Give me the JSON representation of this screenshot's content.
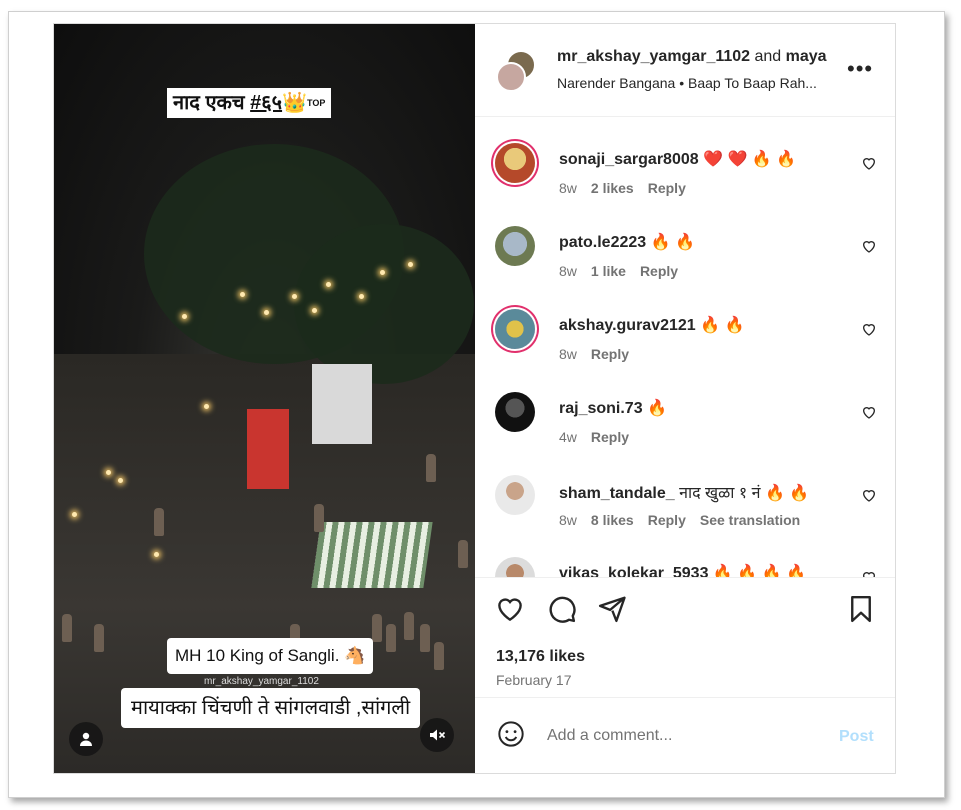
{
  "video": {
    "caption_top": "नाद एकच",
    "caption_top_tag": "#६५",
    "caption_top_emoji": "👑",
    "caption_top_badge": "TOP",
    "caption_mid": "MH 10 King of Sangli. 🐴",
    "caption_handle": "mr_akshay_yamgar_1102",
    "caption_bottom": "मायाक्का चिंचणी ते सांगलवाडी ,सांगली",
    "user_icon": "user-icon",
    "mute_icon": "muted-speaker-icon"
  },
  "header": {
    "author": "mr_akshay_yamgar_1102",
    "joiner": "and",
    "coauthor": "maya",
    "subtitle": "Narender Bangana • Baap To Baap Rah...",
    "more_icon": "•••"
  },
  "comments": [
    {
      "username": "sonaji_sargar8008",
      "text": "❤️ ❤️ 🔥 🔥",
      "age": "8w",
      "likes": "2 likes",
      "reply": "Reply",
      "translate": ""
    },
    {
      "username": "pato.le2223",
      "text": "🔥 🔥",
      "age": "8w",
      "likes": "1 like",
      "reply": "Reply",
      "translate": ""
    },
    {
      "username": "akshay.gurav2121",
      "text": "🔥 🔥",
      "age": "8w",
      "likes": "",
      "reply": "Reply",
      "translate": ""
    },
    {
      "username": "raj_soni.73",
      "text": "🔥",
      "age": "4w",
      "likes": "",
      "reply": "Reply",
      "translate": ""
    },
    {
      "username": "sham_tandale_",
      "text": "नाद खुळा १ नं 🔥 🔥",
      "age": "8w",
      "likes": "8 likes",
      "reply": "Reply",
      "translate": "See translation"
    },
    {
      "username": "vikas_kolekar_5933",
      "text": "🔥 🔥 🔥 🔥",
      "age": "",
      "likes": "",
      "reply": "",
      "translate": ""
    }
  ],
  "actions": {
    "likes": "13,176 likes",
    "date": "February 17"
  },
  "add_comment": {
    "placeholder": "Add a comment...",
    "post_label": "Post"
  },
  "colors": {
    "post_disabled": "#b2dffc",
    "text": "#262626",
    "secondary": "#737373",
    "story_ring": "#e1306c"
  }
}
